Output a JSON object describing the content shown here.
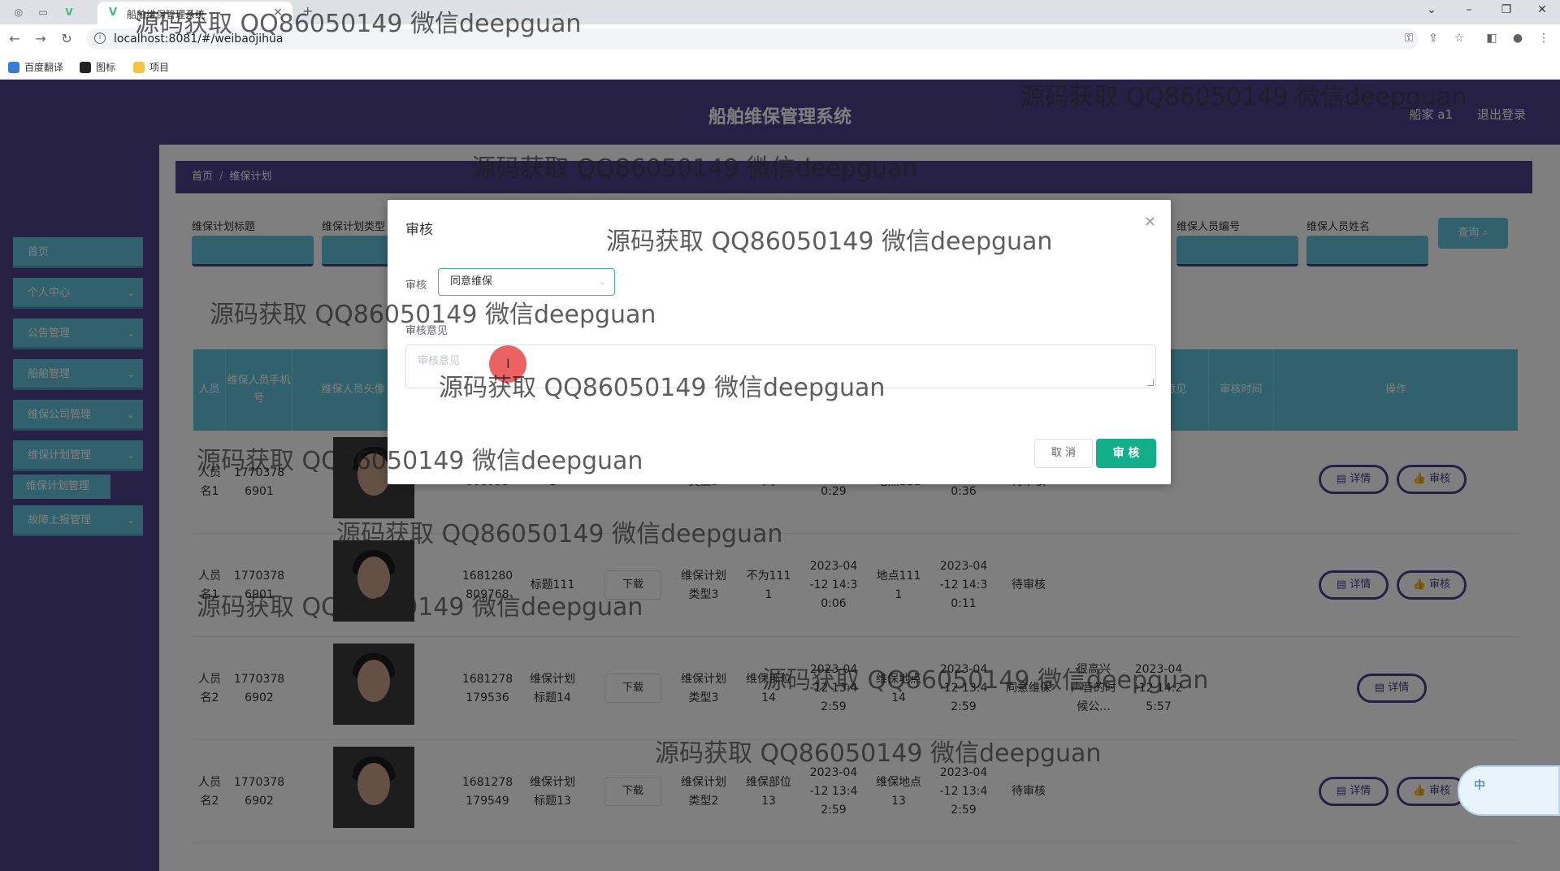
{
  "browser": {
    "tab_title": "船舶维保管理系统",
    "url": "localhost:8081/#/weibaojihua",
    "bookmarks": [
      "百度翻译",
      "图标",
      "项目"
    ]
  },
  "app": {
    "title": "船舶维保管理系统",
    "user": "船家 a1",
    "logout": "退出登录"
  },
  "sidebar": {
    "items": [
      {
        "label": "首页",
        "has_children": false
      },
      {
        "label": "个人中心",
        "has_children": true
      },
      {
        "label": "公告管理",
        "has_children": true
      },
      {
        "label": "船舶管理",
        "has_children": true
      },
      {
        "label": "维保公司管理",
        "has_children": true
      },
      {
        "label": "维保计划管理",
        "has_children": true
      },
      {
        "label": "故障上报管理",
        "has_children": true
      }
    ],
    "submenu_active": "维保计划管理"
  },
  "breadcrumb": {
    "home": "首页",
    "current": "维保计划"
  },
  "search": {
    "fields": [
      "维保计划标题",
      "维保计划类型",
      "维保人员编号",
      "维保人员姓名"
    ],
    "button": "查询"
  },
  "table": {
    "headers": [
      "人员",
      "维保人员手机号",
      "维保人员头像",
      "",
      "",
      "",
      "",
      "",
      "",
      "",
      "",
      "意见",
      "审核时间",
      "操作"
    ],
    "rows": [
      {
        "name": "人员\n名1",
        "phone": "1770378\n6901",
        "id_no": "808955",
        "title": "1",
        "download": "下载",
        "type": "类型3",
        "part": "风",
        "time": "-12 13:0\n0:29",
        "place": "地点111",
        "time2": "-12 13:0\n0:36",
        "status": "待审核",
        "opinion": "",
        "review_time": "",
        "ops": [
          "详情",
          "审核"
        ]
      },
      {
        "name": "人员\n名1",
        "phone": "1770378\n6901",
        "id_no": "1681280\n809768",
        "title": "标题111",
        "download": "下载",
        "type": "维保计划\n类型3",
        "part": "不为111\n1",
        "time": "2023-04\n-12 14:3\n0:06",
        "place": "地点111\n1",
        "time2": "2023-04\n-12 14:3\n0:11",
        "status": "待审核",
        "opinion": "",
        "review_time": "",
        "ops": [
          "详情",
          "审核"
        ]
      },
      {
        "name": "人员\n名2",
        "phone": "1770378\n6902",
        "id_no": "1681278\n179536",
        "title": "维保计划\n标题14",
        "download": "下载",
        "type": "维保计划\n类型3",
        "part": "维保部位\n14",
        "time": "2023-04\n-12 13:4\n2:59",
        "place": "维保地点\n14",
        "time2": "2023-04\n-12 13:4\n2:59",
        "status": "同意维保",
        "opinion": "很高兴\n声音的时\n候公...",
        "review_time": "2023-04\n-12 14:2\n5:57",
        "ops": [
          "详情"
        ]
      },
      {
        "name": "人员\n名2",
        "phone": "1770378\n6902",
        "id_no": "1681278\n179549",
        "title": "维保计划\n标题13",
        "download": "下载",
        "type": "维保计划\n类型2",
        "part": "维保部位\n13",
        "time": "2023-04\n-12 13:4\n2:59",
        "place": "维保地点\n13",
        "time2": "2023-04\n-12 13:4\n2:59",
        "status": "待审核",
        "opinion": "",
        "review_time": "",
        "ops": [
          "详情",
          "审核"
        ]
      }
    ]
  },
  "dialog": {
    "title": "审核",
    "close": "×",
    "status_label": "审核",
    "status_value": "同意维保",
    "opinion_label": "审核意见",
    "opinion_placeholder": "审核意见",
    "cancel": "取 消",
    "confirm": "审 核"
  },
  "watermark": "源码获取 QQ86050149 微信deepguan",
  "ime": "中"
}
